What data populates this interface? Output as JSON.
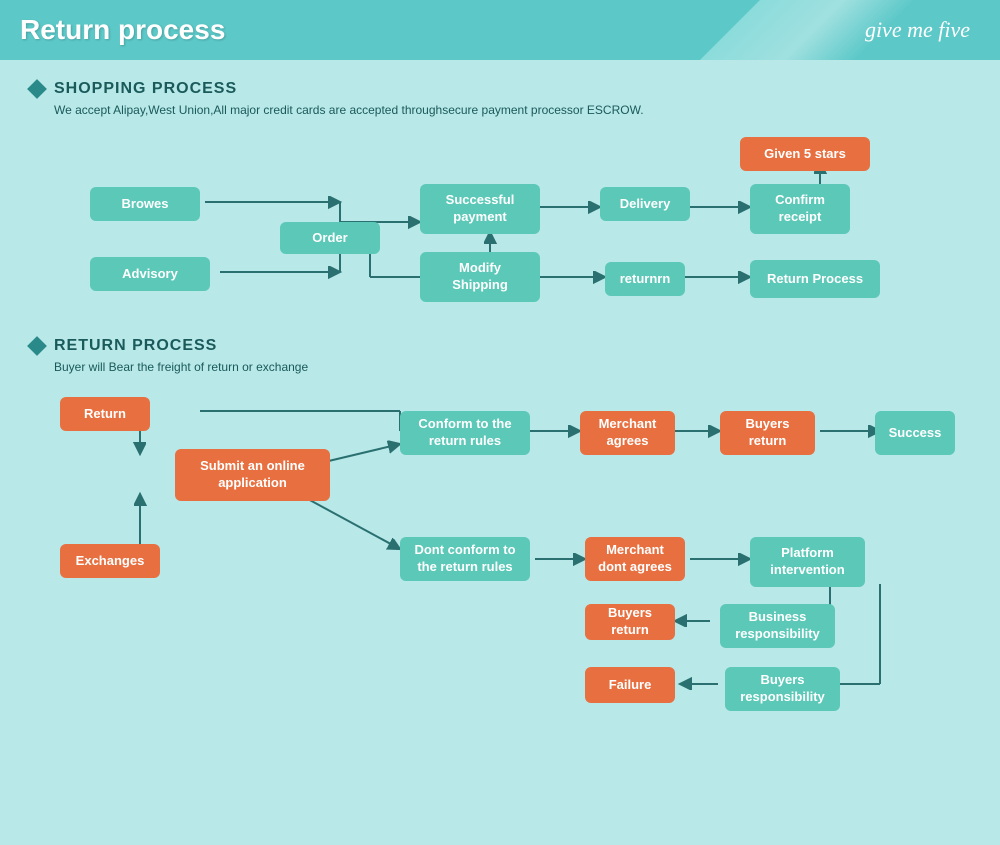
{
  "header": {
    "title": "Return process",
    "brand": "give me five"
  },
  "shopping_section": {
    "title": "SHOPPING PROCESS",
    "description": "We accept Alipay,West Union,All major credit cards are accepted throughsecure payment processor ESCROW.",
    "nodes": {
      "browes": "Browes",
      "order": "Order",
      "advisory": "Advisory",
      "successful_payment": "Successful payment",
      "modify_shipping": "Modify Shipping",
      "delivery": "Delivery",
      "confirm_receipt": "Confirm receipt",
      "given_5_stars": "Given 5 stars",
      "returnrn": "returnrn",
      "return_process": "Return Process"
    }
  },
  "return_section": {
    "title": "RETURN PROCESS",
    "description": "Buyer will Bear the freight of return or exchange",
    "nodes": {
      "return": "Return",
      "submit_online": "Submit an online application",
      "exchanges": "Exchanges",
      "conform": "Conform to the return rules",
      "merchant_agrees": "Merchant agrees",
      "buyers_return_top": "Buyers return",
      "success": "Success",
      "dont_conform": "Dont conform to the return rules",
      "merchant_dont": "Merchant dont agrees",
      "platform": "Platform intervention",
      "buyers_return_bot": "Buyers return",
      "business_resp": "Business responsibility",
      "failure": "Failure",
      "buyers_resp": "Buyers responsibility"
    }
  }
}
